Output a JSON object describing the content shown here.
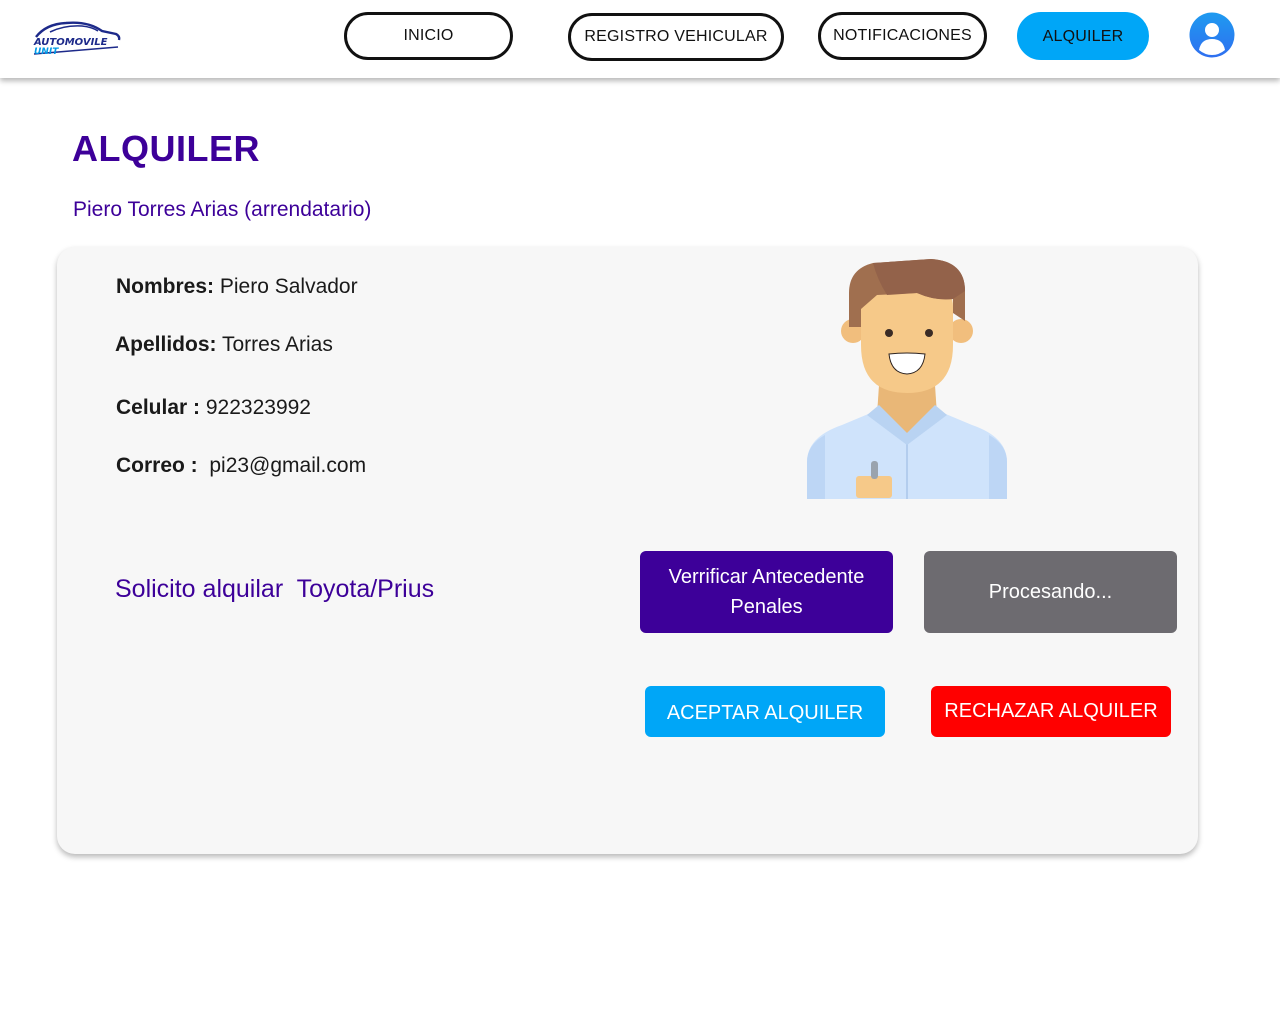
{
  "header": {
    "logo": {
      "line1": "AUTOMOVILE",
      "line2": "UNIT"
    },
    "nav": [
      {
        "label": "INICIO"
      },
      {
        "label": "REGISTRO VEHICULAR"
      },
      {
        "label": "NOTIFICACIONES"
      },
      {
        "label": "ALQUILER",
        "active": true
      }
    ],
    "profile_icon": "user-avatar-icon"
  },
  "page": {
    "title": "ALQUILER",
    "subtitle": "Piero Torres Arias (arrendatario)"
  },
  "renter": {
    "nombres_label": "Nombres:",
    "nombres_value": " Piero Salvador",
    "apellidos_label": "Apellidos:",
    "apellidos_value": " Torres Arias",
    "celular_label": "Celular :",
    "celular_value": " 922323992",
    "correo_label": "Correo :",
    "correo_value": "  pi23@gmail.com",
    "illustration_icon": "man-avatar-icon"
  },
  "request": {
    "text": "Solicito alquilar  Toyota/Prius"
  },
  "actions": {
    "verify_label": "Verrificar Antecedente Penales",
    "processing_label": "Procesando...",
    "accept_label": "ACEPTAR ALQUILER",
    "reject_label": "RECHAZAR ALQUILER"
  },
  "colors": {
    "accent_purple": "#3d0099",
    "accent_blue": "#00a6f7",
    "reject_red": "#ff0000",
    "processing_gray": "#6d6b70",
    "card_bg": "#f7f7f7"
  }
}
